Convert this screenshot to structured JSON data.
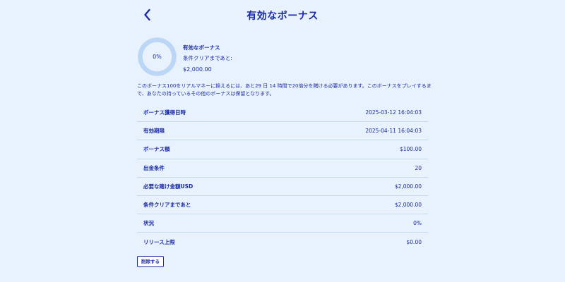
{
  "header": {
    "title": "有効なボーナス",
    "back_icon": "chevron-left-icon"
  },
  "summary": {
    "progress_percent": 0,
    "progress_label": "0%",
    "title": "有効なボーナス",
    "subtitle": "条件クリアまであと:",
    "amount": "$2,000.00"
  },
  "description": "このボーナス100をリアルマネーに換えるには、あと29 日 14 時間で20倍分を賭ける必要があります。このボーナスをプレイするまで、あなたの持っているその他のボーナスは保留となります。",
  "details": [
    {
      "label": "ボーナス獲得日時",
      "value": "2025-03-12 16:04:03"
    },
    {
      "label": "有効期限",
      "value": "2025-04-11 16:04:03"
    },
    {
      "label": "ボーナス額",
      "value": "$100.00"
    },
    {
      "label": "出金条件",
      "value": "20"
    },
    {
      "label": "必要な賭け金額USD",
      "value": "$2,000.00"
    },
    {
      "label": "条件クリアまであと",
      "value": "$2,000.00"
    },
    {
      "label": "状況",
      "value": "0%"
    },
    {
      "label": "リリース上限",
      "value": "$0.00"
    }
  ],
  "actions": {
    "delete_label": "削除する"
  },
  "colors": {
    "background": "#e8f2fd",
    "text": "#1a2aa8",
    "ring": "#bcd6f5",
    "divider": "#c8daf2"
  }
}
